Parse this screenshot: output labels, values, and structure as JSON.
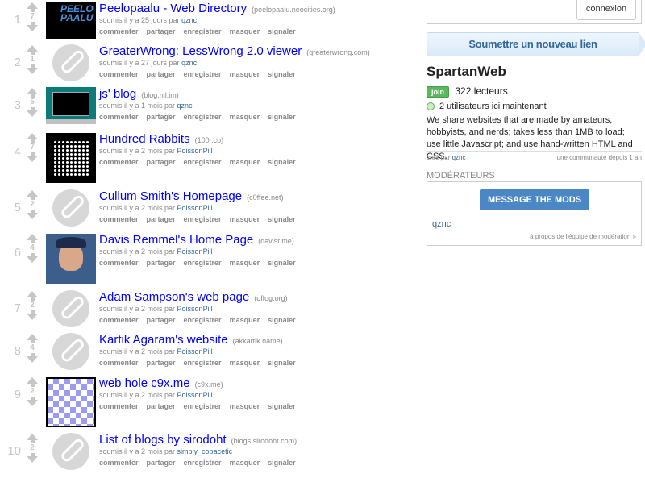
{
  "links": [
    {
      "rank": "1",
      "score": "7",
      "title": "Peelopaalu - Web Directory",
      "domain": "(peelopaalu.neocities.org)",
      "tagline_prefix": "soumis il y a 25 jours par",
      "author": "qznc",
      "thumb": "peelo",
      "thumb_text": "PEELO PAALU"
    },
    {
      "rank": "2",
      "score": "1",
      "title": "GreaterWrong: LessWrong 2.0 viewer",
      "domain": "(greaterwrong.com)",
      "tagline_prefix": "soumis il y a 27 jours par",
      "author": "qznc",
      "thumb": "default"
    },
    {
      "rank": "3",
      "score": "5",
      "title": "js' blog",
      "domain": "(blog.nil.im)",
      "tagline_prefix": "soumis il y a 1 mois par",
      "author": "qznc",
      "thumb": "js"
    },
    {
      "rank": "4",
      "score": "7",
      "title": "Hundred Rabbits",
      "domain": "(100r.co)",
      "tagline_prefix": "soumis il y a 2 mois par",
      "author": "PoissonPill",
      "thumb": "rabbits"
    },
    {
      "rank": "5",
      "score": "2",
      "title": "Cullum Smith's Homepage",
      "domain": "(c0ffee.net)",
      "tagline_prefix": "soumis il y a 2 mois par",
      "author": "PoissonPill",
      "thumb": "default"
    },
    {
      "rank": "6",
      "score": "4",
      "title": "Davis Remmel's Home Page",
      "domain": "(davisr.me)",
      "tagline_prefix": "soumis il y a 2 mois par",
      "author": "PoissonPill",
      "thumb": "davis"
    },
    {
      "rank": "7",
      "score": "2",
      "title": "Adam Sampson's web page",
      "domain": "(offog.org)",
      "tagline_prefix": "soumis il y a 2 mois par",
      "author": "PoissonPill",
      "thumb": "default"
    },
    {
      "rank": "8",
      "score": "4",
      "title": "Kartik Agaram's website",
      "domain": "(akkartik.name)",
      "tagline_prefix": "soumis il y a 2 mois par",
      "author": "PoissonPill",
      "thumb": "default"
    },
    {
      "rank": "9",
      "score": "2",
      "title": "web hole c9x.me",
      "domain": "(c9x.me)",
      "tagline_prefix": "soumis il y a 2 mois par",
      "author": "PoissonPill",
      "thumb": "c9x"
    },
    {
      "rank": "10",
      "score": "2",
      "title": "List of blogs by sirodoht",
      "domain": "(blogs.sirodoht.com)",
      "tagline_prefix": "soumis il y a 2 mois par",
      "author": "simply_copacetic",
      "thumb": "default"
    }
  ],
  "buttons": {
    "comment": "commenter",
    "share": "partager",
    "save": "enregistrer",
    "hide": "masquer",
    "report": "signaler"
  },
  "sidebar": {
    "login_label": "connexion",
    "submit_label": "Soumettre un nouveau lien",
    "sub_name": "SpartanWeb",
    "join_label": "join",
    "readers": "322 lecteurs",
    "online": "2 utilisateurs ici maintenant",
    "description": "We share websites that are made by amateurs, hobbyists, and nerds; takes less than 1MB to load; use little Javascript; and use hand-written HTML and CSS.",
    "created_prefix": "créé par",
    "created_by": "qznc",
    "community_age": "une communauté depuis 1 an",
    "mod_heading": "MODÉRATEURS",
    "mod_button": "MESSAGE THE MODS",
    "mod_name": "qznc",
    "mod_about": "à propos de l'équipe de modération »"
  },
  "colors": {
    "link": "#0000ff",
    "author": "#336699",
    "join": "#5cb85c",
    "mod_button": "#4a87c4"
  }
}
